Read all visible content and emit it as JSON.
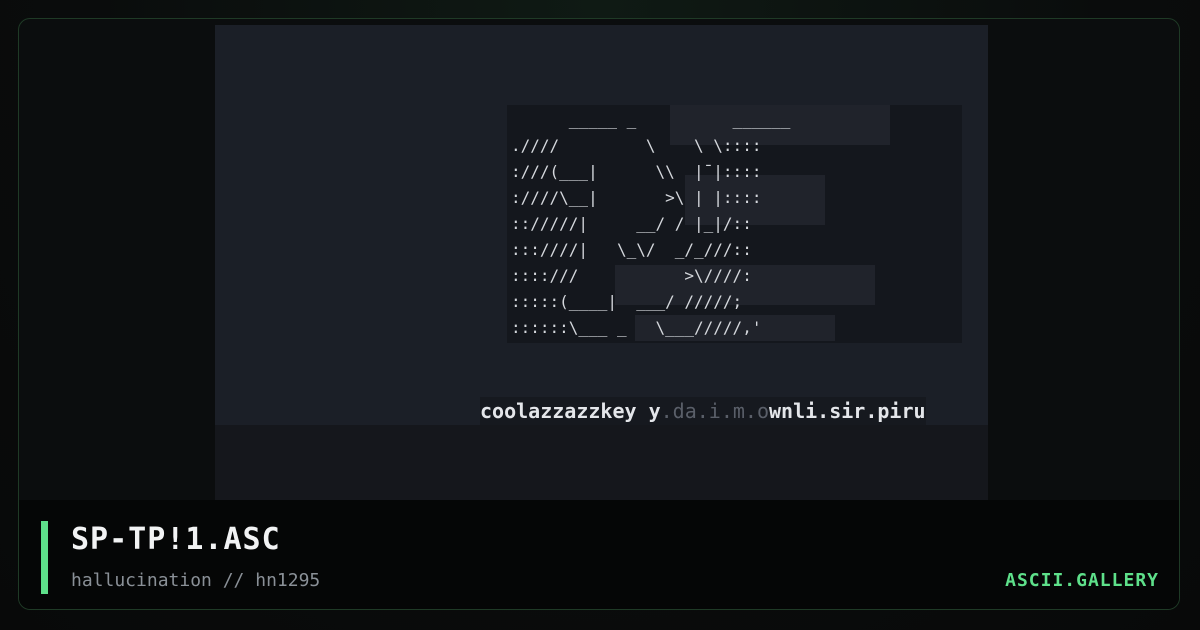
{
  "artwork": {
    "ascii_lines": [
      "      _____ _          ______",
      ".////         \\    \\ \\::::",
      ":///(___|      \\\\  |¯|::::",
      ":////\\__|       >\\ | |::::",
      ":://///|     __/ / |_|/::",
      ":::////|   \\_\\/  _/_///::",
      "::::///           >\\////:",
      ":::::(____|  ___/ /////;",
      "::::::\\___ _   \\___/////,'"
    ],
    "credit_left": "coolazzazzkey",
    "credit_mid_1": " y",
    "credit_mid_2": ".da.i.m.o",
    "credit_right": "wnli.sir.piru"
  },
  "info": {
    "title": "SP-TP!1.ASC",
    "subtitle": "hallucination // hn1295",
    "brand": "ASCII.GALLERY"
  },
  "colors": {
    "accent": "#5ee08a",
    "background": "#0b0d0e",
    "art_background": "#1b1f27"
  }
}
